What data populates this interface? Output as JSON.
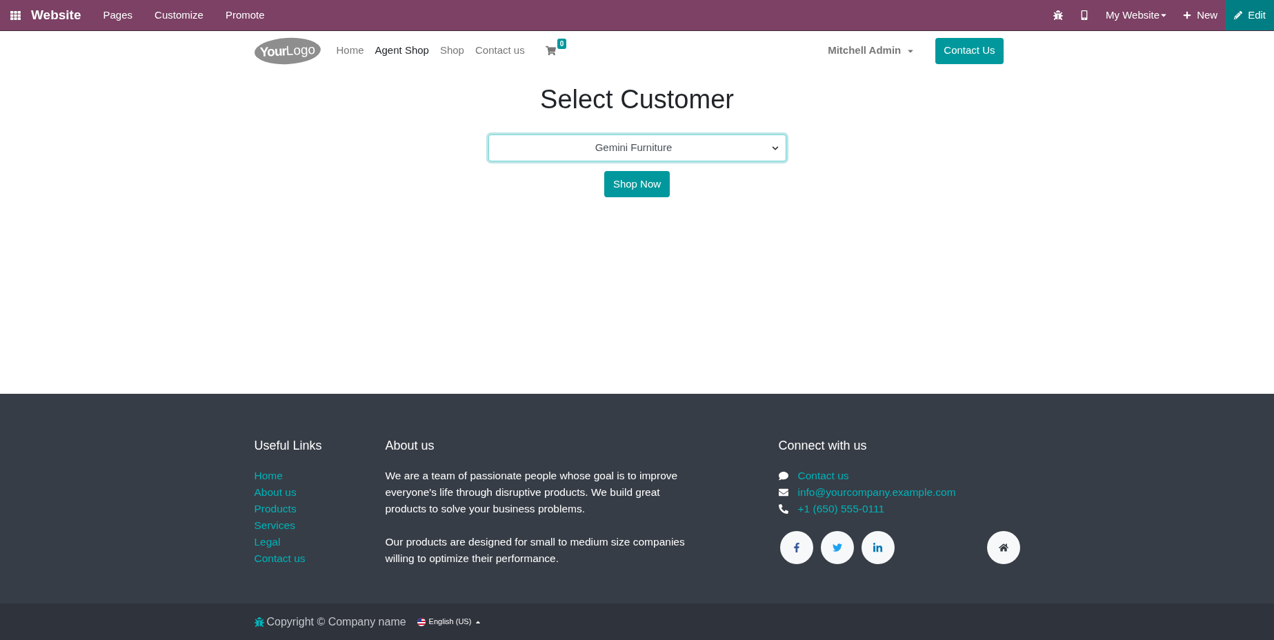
{
  "topbar": {
    "app_title": "Website",
    "menu": [
      "Pages",
      "Customize",
      "Promote"
    ],
    "website_menu": "My Website",
    "new_button": "New",
    "edit_button": "Edit"
  },
  "header": {
    "logo": {
      "part_1": "Your",
      "part_2": "Logo"
    },
    "nav": [
      {
        "label": "Home",
        "selected": false
      },
      {
        "label": "Agent Shop",
        "selected": true
      },
      {
        "label": "Shop",
        "selected": false
      },
      {
        "label": "Contact us",
        "selected": false
      }
    ],
    "cart_count": "0",
    "user_menu": "Mitchell Admin",
    "contact_button": "Contact Us"
  },
  "main": {
    "title": "Select Customer",
    "customer_select": {
      "value": "Gemini Furniture"
    },
    "shop_button": "Shop Now"
  },
  "footer": {
    "useful_links": {
      "title": "Useful Links",
      "links": [
        "Home",
        "About us",
        "Products",
        "Services",
        "Legal",
        "Contact us"
      ]
    },
    "about": {
      "title": "About us",
      "paragraphs": [
        "We are a team of passionate people whose goal is to improve everyone's life through disruptive products. We build great products to solve your business problems.",
        "Our products are designed for small to medium size companies willing to optimize their performance."
      ]
    },
    "connect": {
      "title": "Connect with us",
      "items": [
        {
          "kind": "chat",
          "label": "Contact us"
        },
        {
          "kind": "email",
          "label": "info@yourcompany.example.com"
        },
        {
          "kind": "phone",
          "label": "+1 (650) 555-0111"
        }
      ],
      "social": [
        {
          "kind": "facebook"
        },
        {
          "kind": "twitter"
        },
        {
          "kind": "linkedin"
        },
        {
          "kind": "home"
        }
      ]
    }
  },
  "bottom_bar": {
    "copyright": "Copyright © Company name",
    "language": "English (US)"
  }
}
